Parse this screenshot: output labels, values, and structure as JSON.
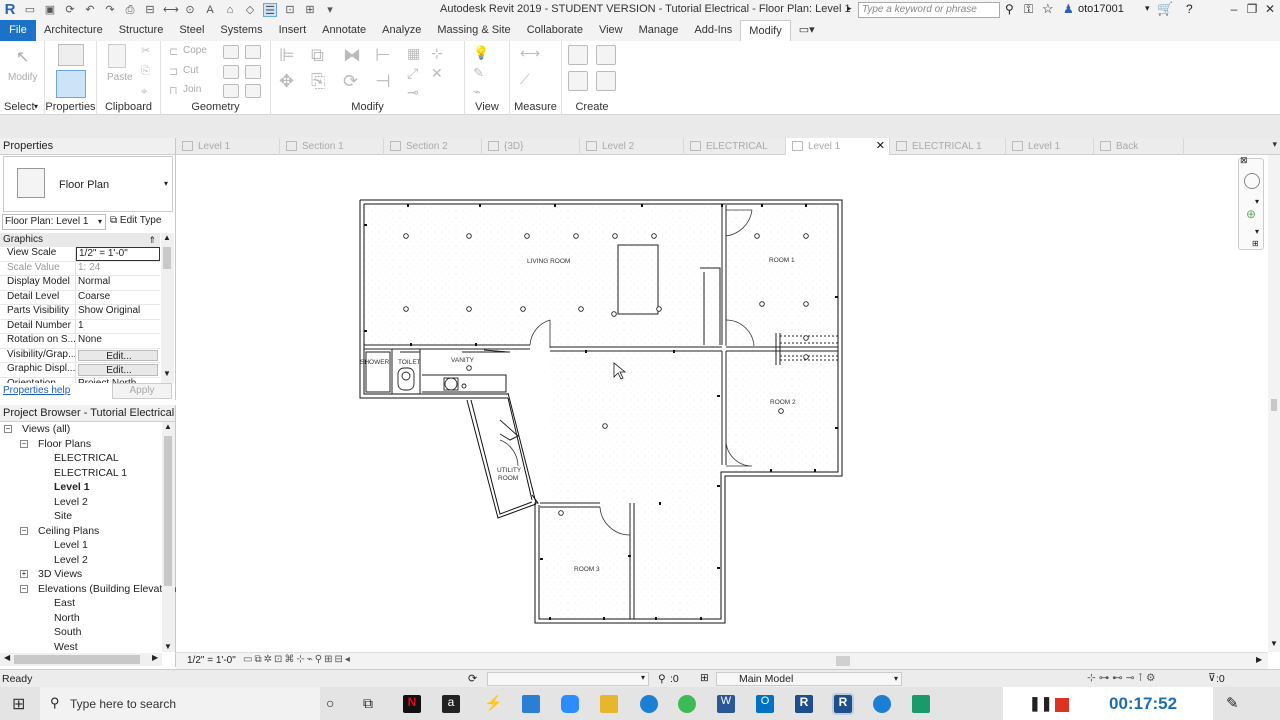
{
  "app": {
    "logo": "R",
    "title": "Autodesk Revit 2019 - STUDENT VERSION - Tutorial Electrical - Floor Plan: Level 1",
    "search_placeholder": "Type a keyword or phrase",
    "user": "oto17001",
    "accent": "#1a73c8"
  },
  "menu_tabs": [
    "File",
    "Architecture",
    "Structure",
    "Steel",
    "Systems",
    "Insert",
    "Annotate",
    "Analyze",
    "Massing & Site",
    "Collaborate",
    "View",
    "Manage",
    "Add-Ins",
    "Modify"
  ],
  "active_menu_tab": "Modify",
  "ribbon": {
    "panels": [
      "Select",
      "Properties",
      "Clipboard",
      "Geometry",
      "Modify",
      "View",
      "Measure",
      "Create"
    ],
    "buttons": {
      "modify": "Modify",
      "paste": "Paste",
      "cope": "Cope",
      "cut": "Cut",
      "join": "Join"
    }
  },
  "view_tabs": [
    "Level 1",
    "Section 1",
    "Section 2",
    "{3D}",
    "Level 2",
    "ELECTRICAL",
    "Level 1",
    "ELECTRICAL 1",
    "Level 1",
    "Back"
  ],
  "active_view_tab_index": 6,
  "properties": {
    "title": "Properties",
    "type_name": "Floor Plan",
    "instance_selector": "Floor Plan: Level 1",
    "edit_type": "Edit Type",
    "section": "Graphics",
    "rows": [
      {
        "k": "View Scale",
        "v": "1/2\" = 1'-0\""
      },
      {
        "k": "Scale Value",
        "v": "1:  24"
      },
      {
        "k": "Display Model",
        "v": "Normal"
      },
      {
        "k": "Detail Level",
        "v": "Coarse"
      },
      {
        "k": "Parts Visibility",
        "v": "Show Original"
      },
      {
        "k": "Detail Number",
        "v": "1"
      },
      {
        "k": "Rotation on S...",
        "v": "None"
      },
      {
        "k": "Visibility/Grap...",
        "v": "Edit..."
      },
      {
        "k": "Graphic Displ...",
        "v": "Edit..."
      },
      {
        "k": "Orientation",
        "v": "Project North"
      }
    ],
    "help_link": "Properties help",
    "apply": "Apply"
  },
  "browser": {
    "title": "Project Browser - Tutorial Electrical",
    "items": [
      {
        "label": "Views (all)",
        "level": 0,
        "bold": false
      },
      {
        "label": "Floor Plans",
        "level": 1,
        "bold": false
      },
      {
        "label": "ELECTRICAL",
        "level": 2,
        "bold": false
      },
      {
        "label": "ELECTRICAL 1",
        "level": 2,
        "bold": false
      },
      {
        "label": "Level 1",
        "level": 2,
        "bold": true
      },
      {
        "label": "Level 2",
        "level": 2,
        "bold": false
      },
      {
        "label": "Site",
        "level": 2,
        "bold": false
      },
      {
        "label": "Ceiling Plans",
        "level": 1,
        "bold": false
      },
      {
        "label": "Level 1",
        "level": 2,
        "bold": false
      },
      {
        "label": "Level 2",
        "level": 2,
        "bold": false
      },
      {
        "label": "3D Views",
        "level": 1,
        "bold": false
      },
      {
        "label": "Elevations (Building Elevation",
        "level": 1,
        "bold": false
      },
      {
        "label": "East",
        "level": 2,
        "bold": false
      },
      {
        "label": "North",
        "level": 2,
        "bold": false
      },
      {
        "label": "South",
        "level": 2,
        "bold": false
      },
      {
        "label": "West",
        "level": 2,
        "bold": false
      }
    ]
  },
  "plan": {
    "labels": {
      "living": "LIVING ROOM",
      "room1": "ROOM 1",
      "room2": "ROOM 2",
      "room3": "ROOM 3",
      "vanity": "VANITY",
      "shower": "SHOWER",
      "toilet": "TOILET",
      "utility1": "UTILITY",
      "utility2": "ROOM"
    }
  },
  "view_control": {
    "scale": "1/2\" = 1'-0\""
  },
  "status": {
    "text": "Ready",
    "zero": ":0",
    "model": "Main Model",
    "filter": ":0"
  },
  "taskbar": {
    "search": "Type here to search",
    "timer": "00:17:52"
  }
}
